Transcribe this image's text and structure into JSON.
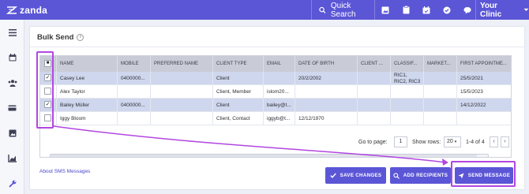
{
  "app": {
    "logo_text": "zanda",
    "quick_search_label": "Quick Search",
    "user_menu_label": "Your Clinic",
    "top_icons": [
      "image-icon",
      "clipboard-icon",
      "calendar-check-icon",
      "check-circle-icon",
      "chat-icon"
    ]
  },
  "sidebar": {
    "items": [
      "menu-icon",
      "calendar-icon",
      "users-icon",
      "card-icon",
      "image-icon",
      "chart-icon",
      "wrench-icon"
    ]
  },
  "page": {
    "title": "Bulk Send",
    "info_icon_glyph": "i"
  },
  "grid": {
    "columns": [
      "Name",
      "Mobile",
      "Preferred Name",
      "Client Type",
      "Email",
      "Date of Birth",
      "Client ...",
      "Classif...",
      "Market...",
      "First Appointme..."
    ],
    "rows": [
      {
        "checked": true,
        "selected": true,
        "cells": [
          "Casey Lee",
          "0400000...",
          "",
          "Client",
          "",
          "20/2/2002",
          "",
          "RIC1,\nRIC2, RIC3",
          "",
          "25/5/2021"
        ]
      },
      {
        "checked": false,
        "selected": false,
        "cells": [
          "Alex Taylor",
          "",
          "",
          "Client, Member",
          "islom20...",
          "",
          "",
          "",
          "",
          "15/5/2023"
        ]
      },
      {
        "checked": true,
        "selected": true,
        "cells": [
          "Bailey Müller",
          "0400000...",
          "",
          "Client",
          "bailey@t...",
          "",
          "",
          "",
          "",
          "14/12/2022"
        ]
      },
      {
        "checked": false,
        "selected": false,
        "cells": [
          "Iggy Bloom",
          "",
          "",
          "Client, Contact",
          "iggyb@t...",
          "12/12/1970",
          "",
          "",
          "",
          ""
        ]
      }
    ],
    "check_glyph": "✓",
    "header_checkbox_glyph": "■"
  },
  "pager": {
    "go_to_label": "Go to page:",
    "page_value": "1",
    "show_rows_label": "Show rows:",
    "rows_value": "20",
    "range_text": "1-4 of 4",
    "prev_glyph": "‹",
    "next_glyph": "›"
  },
  "footer": {
    "about_link": "About SMS Messages",
    "save_changes": "Save Changes",
    "add_recipients": "Add Recipients",
    "send_message": "Send Message"
  },
  "colors": {
    "brand": "#5b56d6",
    "selected_row": "#cfd7ee",
    "annotation": "#b246e0"
  }
}
